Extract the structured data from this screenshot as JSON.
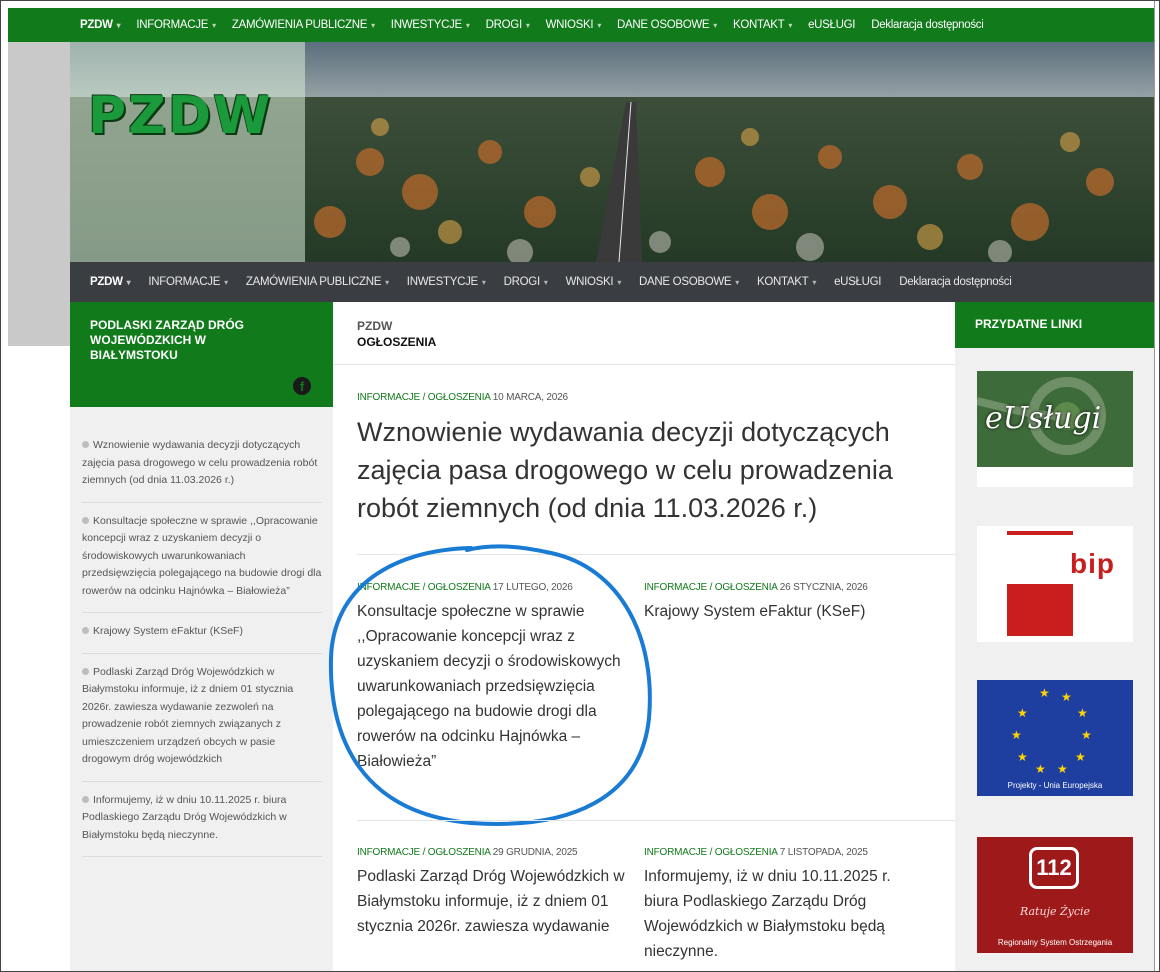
{
  "nav": {
    "items": [
      {
        "label": "PZDW",
        "dropdown": true,
        "active": true
      },
      {
        "label": "INFORMACJE",
        "dropdown": true
      },
      {
        "label": "ZAMÓWIENIA PUBLICZNE",
        "dropdown": true
      },
      {
        "label": "INWESTYCJE",
        "dropdown": true
      },
      {
        "label": "DROGI",
        "dropdown": true
      },
      {
        "label": "WNIOSKI",
        "dropdown": true
      },
      {
        "label": "DANE OSOBOWE",
        "dropdown": true
      },
      {
        "label": "KONTAKT",
        "dropdown": true
      },
      {
        "label": "eUSŁUGI",
        "dropdown": false
      },
      {
        "label": "Deklaracja dostępności",
        "dropdown": false
      }
    ],
    "caret": "▾"
  },
  "header": {
    "logo": "PZDW"
  },
  "sidebar_left": {
    "org_title": "PODLASKI ZARZĄD DRÓG WOJEWÓDZKICH W BIAŁYMSTOKU",
    "facebook_icon": "facebook-icon",
    "items": [
      "Wznowienie wydawania decyzji dotyczących zajęcia pasa drogowego w celu prowadzenia robót ziemnych (od dnia 11.03.2026 r.)",
      "Konsultacje społeczne w sprawie ,,Opracowanie koncepcji wraz z uzyskaniem decyzji o środowiskowych uwarunkowaniach przedsięwzięcia polegającego na budowie drogi dla rowerów na odcinku Hajnówka – Białowieża”",
      "Krajowy System eFaktur (KSeF)",
      "Podlaski Zarząd Dróg Wojewódzkich w Białymstoku informuje, iż z dniem 01 stycznia 2026r. zawiesza wydawanie zezwoleń na prowadzenie robót ziemnych związanych z umieszczeniem urządzeń obcych w pasie drogowym dróg wojewódzkich",
      "Informujemy, iż w dniu 10.11.2025 r. biura Podlaskiego Zarządu Dróg Wojewódzkich w Białymstoku będą nieczynne."
    ]
  },
  "breadcrumb": {
    "parent": "PZDW",
    "current": "OGŁOSZENIA"
  },
  "featured": {
    "category": "INFORMACJE / OGŁOSZENIA",
    "date": "10 MARCA, 2026",
    "title": "Wznowienie wydawania decyzji dotyczących zajęcia pasa drogowego w celu prowadzenia robót ziemnych (od dnia 11.03.2026 r.)"
  },
  "posts": [
    {
      "category": "INFORMACJE / OGŁOSZENIA",
      "date": "17 LUTEGO, 2026",
      "title": "Konsultacje społeczne w sprawie ,,Opracowanie koncepcji wraz z uzyskaniem decyzji o środowiskowych uwarunkowaniach przedsięwzięcia polegającego na budowie drogi dla rowerów na odcinku Hajnówka – Białowieża”"
    },
    {
      "category": "INFORMACJE / OGŁOSZENIA",
      "date": "26 STYCZNIA, 2026",
      "title": "Krajowy System eFaktur (KSeF)"
    },
    {
      "category": "INFORMACJE / OGŁOSZENIA",
      "date": "29 GRUDNIA, 2025",
      "title": "Podlaski Zarząd Dróg Wojewódzkich w Białymstoku informuje, iż z dniem 01 stycznia 2026r. zawiesza wydawanie"
    },
    {
      "category": "INFORMACJE / OGŁOSZENIA",
      "date": "7 LISTOPADA, 2025",
      "title": "Informujemy, iż w dniu 10.11.2025 r. biura Podlaskiego Zarządu Dróg Wojewódzkich w Białymstoku będą nieczynne."
    }
  ],
  "sidebar_right": {
    "title": "PRZYDATNE LINKI",
    "banners": {
      "eusługi": "eUsługi",
      "bip": "bip",
      "eu_caption": "Projekty - Unia Europejska",
      "rso_number": "112",
      "rso_slogan": "Ratuje Życie",
      "rso_caption": "Regionalny System Ostrzegania"
    }
  },
  "colors": {
    "brand_green": "#117a1b",
    "subnav_dark": "#3a3d42",
    "highlight_blue": "#1a7bd4"
  }
}
